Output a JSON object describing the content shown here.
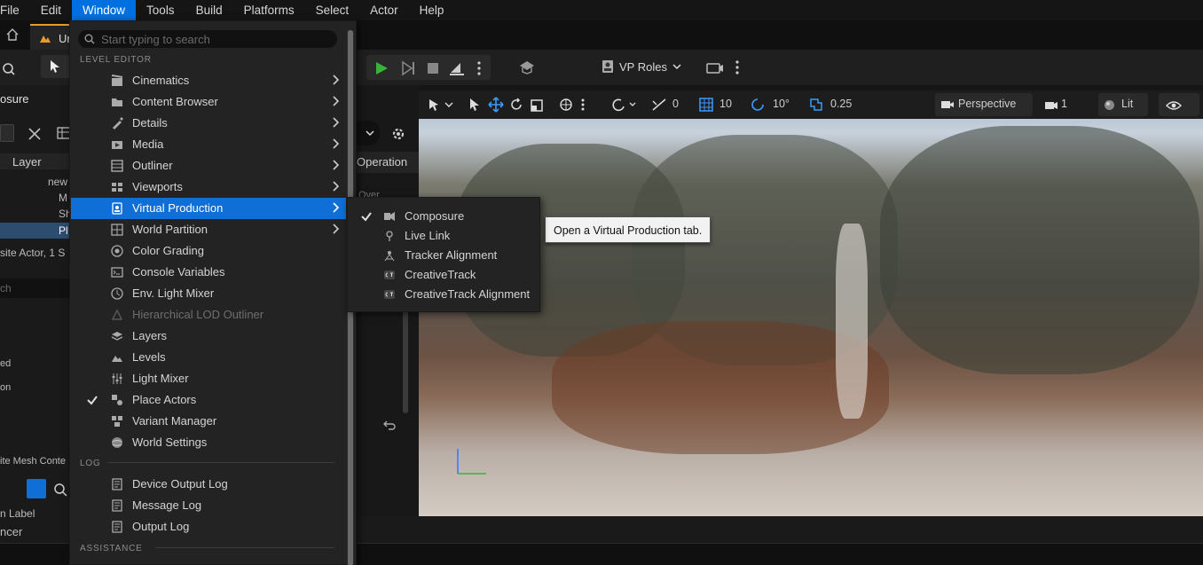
{
  "menubar": {
    "items": [
      "File",
      "Edit",
      "Window",
      "Tools",
      "Build",
      "Platforms",
      "Select",
      "Actor",
      "Help"
    ],
    "active": "Window"
  },
  "tabs": {
    "doc_tab": "Ur"
  },
  "toolbar": {
    "vp_roles": "VP Roles"
  },
  "outliner": {
    "title": "osure",
    "column_layer": "Layer",
    "tree": [
      "new",
      "M",
      "Sh",
      "Pl"
    ],
    "status": "site Actor, 1 S",
    "search": "ch",
    "row_a": "ed",
    "row_b": "on",
    "footer": "ite Mesh Conte",
    "col_label": "n Label",
    "bottom": "ncer"
  },
  "composure_panel": {
    "operation_header": "Operation",
    "row_text": "Over"
  },
  "viewport": {
    "view_mode": "Perspective",
    "lit": "Lit",
    "translate_snap": "0",
    "grid_snap": "10",
    "rotate_snap": "10°",
    "scale_snap": "0.25",
    "camera_speed": "1"
  },
  "window_menu": {
    "search_placeholder": "Start typing to search",
    "sections": {
      "level_editor": "LEVEL EDITOR",
      "log": "LOG",
      "assistance": "ASSISTANCE"
    },
    "level_editor_items": [
      {
        "label": "Cinematics",
        "icon": "cinematics-icon",
        "submenu": true
      },
      {
        "label": "Content Browser",
        "icon": "content-browser-icon",
        "submenu": true
      },
      {
        "label": "Details",
        "icon": "details-icon",
        "submenu": true
      },
      {
        "label": "Media",
        "icon": "media-icon",
        "submenu": true
      },
      {
        "label": "Outliner",
        "icon": "outliner-icon",
        "submenu": true
      },
      {
        "label": "Viewports",
        "icon": "viewports-icon",
        "submenu": true
      },
      {
        "label": "Virtual Production",
        "icon": "virtual-production-icon",
        "submenu": true,
        "highlighted": true
      },
      {
        "label": "World Partition",
        "icon": "world-partition-icon",
        "submenu": true
      },
      {
        "label": "Color Grading",
        "icon": "color-grading-icon"
      },
      {
        "label": "Console Variables",
        "icon": "console-variables-icon"
      },
      {
        "label": "Env. Light Mixer",
        "icon": "env-light-mixer-icon"
      },
      {
        "label": "Hierarchical LOD Outliner",
        "icon": "hlod-outliner-icon",
        "disabled": true
      },
      {
        "label": "Layers",
        "icon": "layers-icon"
      },
      {
        "label": "Levels",
        "icon": "levels-icon"
      },
      {
        "label": "Light Mixer",
        "icon": "light-mixer-icon"
      },
      {
        "label": "Place Actors",
        "icon": "place-actors-icon",
        "checked": true
      },
      {
        "label": "Variant Manager",
        "icon": "variant-manager-icon"
      },
      {
        "label": "World Settings",
        "icon": "world-settings-icon"
      }
    ],
    "log_items": [
      {
        "label": "Device Output Log",
        "icon": "device-output-log-icon"
      },
      {
        "label": "Message Log",
        "icon": "message-log-icon"
      },
      {
        "label": "Output Log",
        "icon": "output-log-icon"
      }
    ]
  },
  "vp_submenu": {
    "items": [
      {
        "label": "Composure",
        "icon": "composure-icon",
        "checked": true
      },
      {
        "label": "Live Link",
        "icon": "live-link-icon"
      },
      {
        "label": "Tracker Alignment",
        "icon": "tracker-alignment-icon"
      },
      {
        "label": "CreativeTrack",
        "icon": "creativetrack-icon"
      },
      {
        "label": "CreativeTrack Alignment",
        "icon": "creativetrack-alignment-icon"
      }
    ]
  },
  "tooltip": "Open a Virtual Production tab.",
  "colors": {
    "accent": "#0070E0",
    "highlight": "#0F6FD6",
    "play": "#3BB33B",
    "tab_accent": "#E89A2C"
  }
}
